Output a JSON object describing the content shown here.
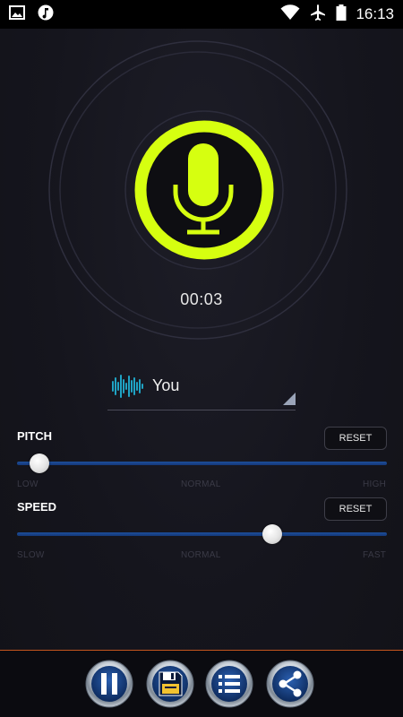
{
  "status_bar": {
    "time": "16:13",
    "icons": [
      "image-icon",
      "music-note-icon",
      "wifi-icon",
      "airplane-icon",
      "battery-icon"
    ]
  },
  "recorder": {
    "timer": "00:03",
    "accent_color": "#d6ff10"
  },
  "voice": {
    "selected": "You",
    "icon": "waveform-icon"
  },
  "pitch": {
    "label": "PITCH",
    "reset_label": "RESET",
    "low_label": "LOW",
    "mid_label": "NORMAL",
    "high_label": "HIGH",
    "value": 0.06
  },
  "speed": {
    "label": "SPEED",
    "reset_label": "RESET",
    "low_label": "SLOW",
    "mid_label": "NORMAL",
    "high_label": "FAST",
    "value": 0.69
  },
  "toolbar": {
    "buttons": [
      "pause-icon",
      "save-icon",
      "list-icon",
      "share-icon"
    ]
  }
}
